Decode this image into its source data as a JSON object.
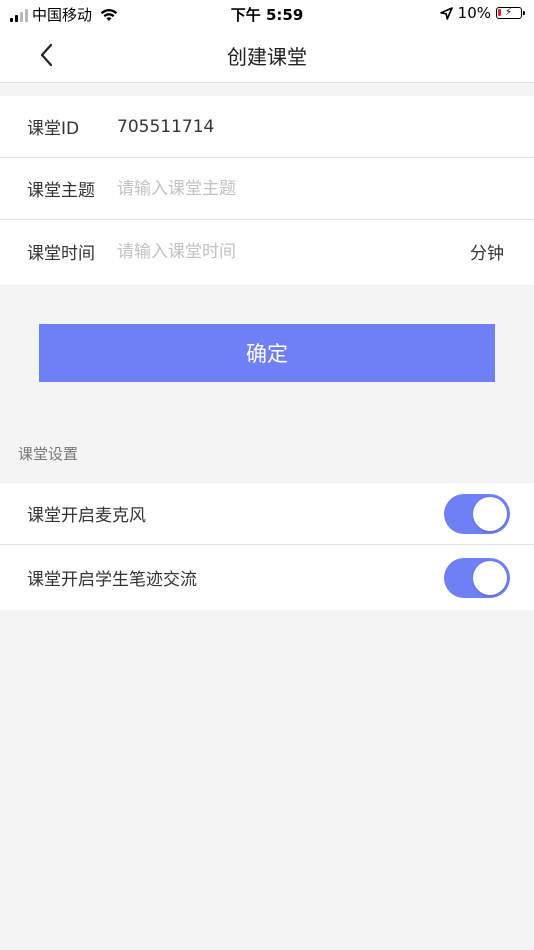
{
  "status_bar": {
    "carrier": "中国移动",
    "time": "下午 5:59",
    "battery": "10%"
  },
  "nav": {
    "title": "创建课堂"
  },
  "form": {
    "rows": [
      {
        "label": "课堂ID",
        "value": "705511714"
      },
      {
        "label": "课堂主题",
        "placeholder": "请输入课堂主题"
      },
      {
        "label": "课堂时间",
        "placeholder": "请输入课堂时间",
        "unit": "分钟"
      }
    ]
  },
  "confirm_label": "确定",
  "settings": {
    "section_title": "课堂设置",
    "items": [
      {
        "label": "课堂开启麦克风",
        "enabled": true
      },
      {
        "label": "课堂开启学生笔迹交流",
        "enabled": true
      }
    ]
  },
  "colors": {
    "accent": "#6e80f4",
    "battery_low": "#e3272b"
  }
}
